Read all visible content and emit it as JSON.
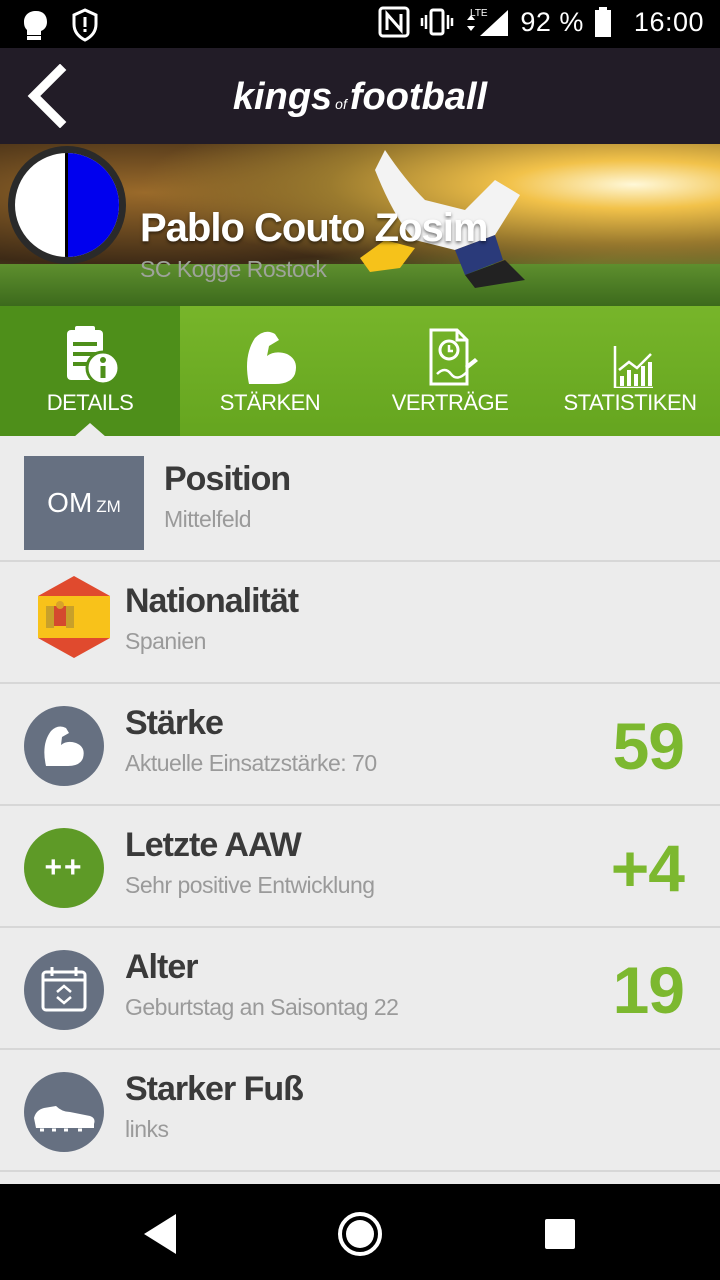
{
  "status_bar": {
    "battery": "92 %",
    "time": "16:00",
    "network": "LTE"
  },
  "app_bar": {
    "logo_part1": "kings",
    "logo_of": "of",
    "logo_part2": "football"
  },
  "player": {
    "name": "Pablo Couto Zosim",
    "club": "SC Kogge Rostock",
    "crest_colors": [
      "#ffffff",
      "#0000ee"
    ]
  },
  "tabs": [
    {
      "label": "DETAILS",
      "icon": "details-icon",
      "active": true
    },
    {
      "label": "STÄRKEN",
      "icon": "strength-icon",
      "active": false
    },
    {
      "label": "VERTRÄGE",
      "icon": "contract-icon",
      "active": false
    },
    {
      "label": "STATISTIKEN",
      "icon": "statistics-icon",
      "active": false
    }
  ],
  "details": {
    "position": {
      "badge_main": "OM",
      "badge_sub": "ZM",
      "title": "Position",
      "subtitle": "Mittelfeld"
    },
    "nationality": {
      "title": "Nationalität",
      "subtitle": "Spanien",
      "icon": "spain-flag-icon"
    },
    "strength": {
      "title": "Stärke",
      "subtitle": "Aktuelle Einsatzstärke: 70",
      "value": "59",
      "icon": "muscle-icon"
    },
    "last_aaw": {
      "title": "Letzte AAW",
      "subtitle": "Sehr positive Entwicklung",
      "value": "+4",
      "badge": "++"
    },
    "age": {
      "title": "Alter",
      "subtitle": "Geburtstag an Saisontag 22",
      "value": "19",
      "icon": "calendar-icon"
    },
    "foot": {
      "title": "Starker Fuß",
      "subtitle": "links",
      "icon": "boot-icon"
    }
  },
  "colors": {
    "accent_green": "#7cb82f",
    "tab_green": "#6aab22",
    "app_bar": "#221c27",
    "icon_gray": "#667081"
  }
}
